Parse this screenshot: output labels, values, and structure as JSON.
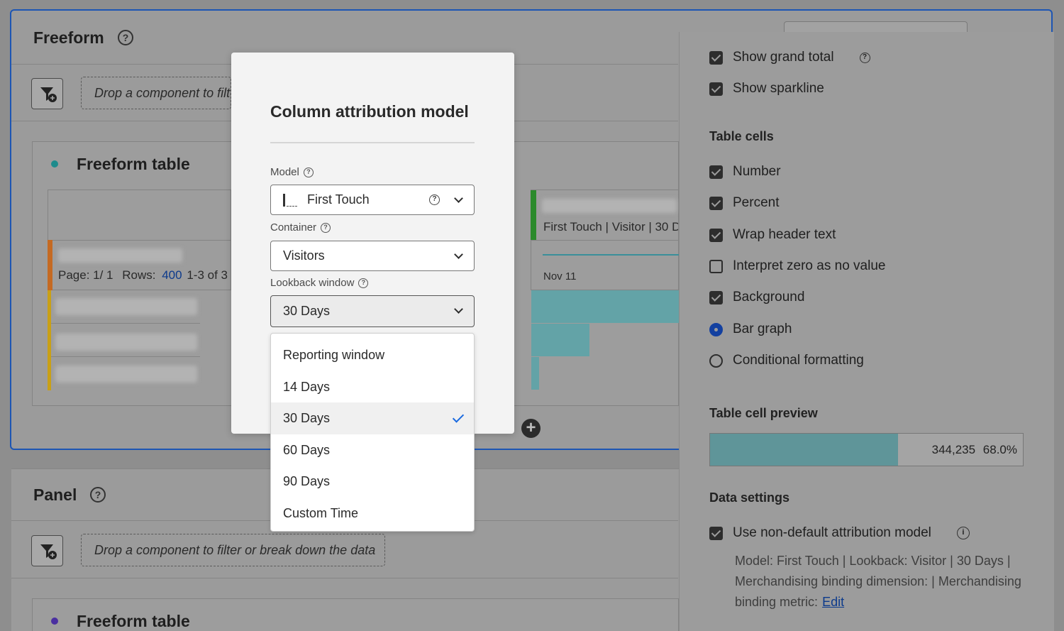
{
  "top_panel": {
    "title": "Freeform",
    "drop_zone": "Drop a component to filter or break down the data",
    "table": {
      "title": "Freeform table",
      "pagination_page": "Page: 1/ 1",
      "pagination_rows_label": "Rows:",
      "pagination_rows_value": "400",
      "pagination_range": "1-3 of 3",
      "column_header": "First Touch | Visitor | 30 Days",
      "date_label": "Nov 11"
    }
  },
  "bottom_panel": {
    "title": "Panel",
    "drop_zone": "Drop a component to filter or break down the data",
    "table_title": "Freeform table"
  },
  "settings": {
    "show_grand_total": "Show grand total",
    "show_sparkline": "Show sparkline",
    "table_cells_heading": "Table cells",
    "cells": {
      "number": "Number",
      "percent": "Percent",
      "wrap_header": "Wrap header text",
      "zero_no_value": "Interpret zero as no value",
      "background": "Background",
      "bar_graph": "Bar graph",
      "conditional": "Conditional formatting"
    },
    "preview_heading": "Table cell preview",
    "preview_value": "344,235",
    "preview_percent": "68.0%",
    "preview_fill_fraction": 0.6,
    "data_settings_heading": "Data settings",
    "non_default_attr": "Use non-default attribution model",
    "attr_description": "Model: First Touch | Lookback: Visitor | 30 Days | Merchandising binding dimension: | Merchandising binding metric:",
    "edit_link": "Edit"
  },
  "modal": {
    "title": "Column attribution model",
    "model_label": "Model",
    "model_value": "First Touch",
    "container_label": "Container",
    "container_value": "Visitors",
    "lookback_label": "Lookback window",
    "lookback_value": "30 Days",
    "lookback_options": [
      "Reporting window",
      "14 Days",
      "30 Days",
      "60 Days",
      "90 Days",
      "Custom Time"
    ],
    "lookback_selected_index": 2
  },
  "colors": {
    "panel_border": "#1d55b3",
    "dropdown_check": "#1a6ae0",
    "bar_teal": "#63a3a7",
    "link": "#0c3a8c"
  }
}
